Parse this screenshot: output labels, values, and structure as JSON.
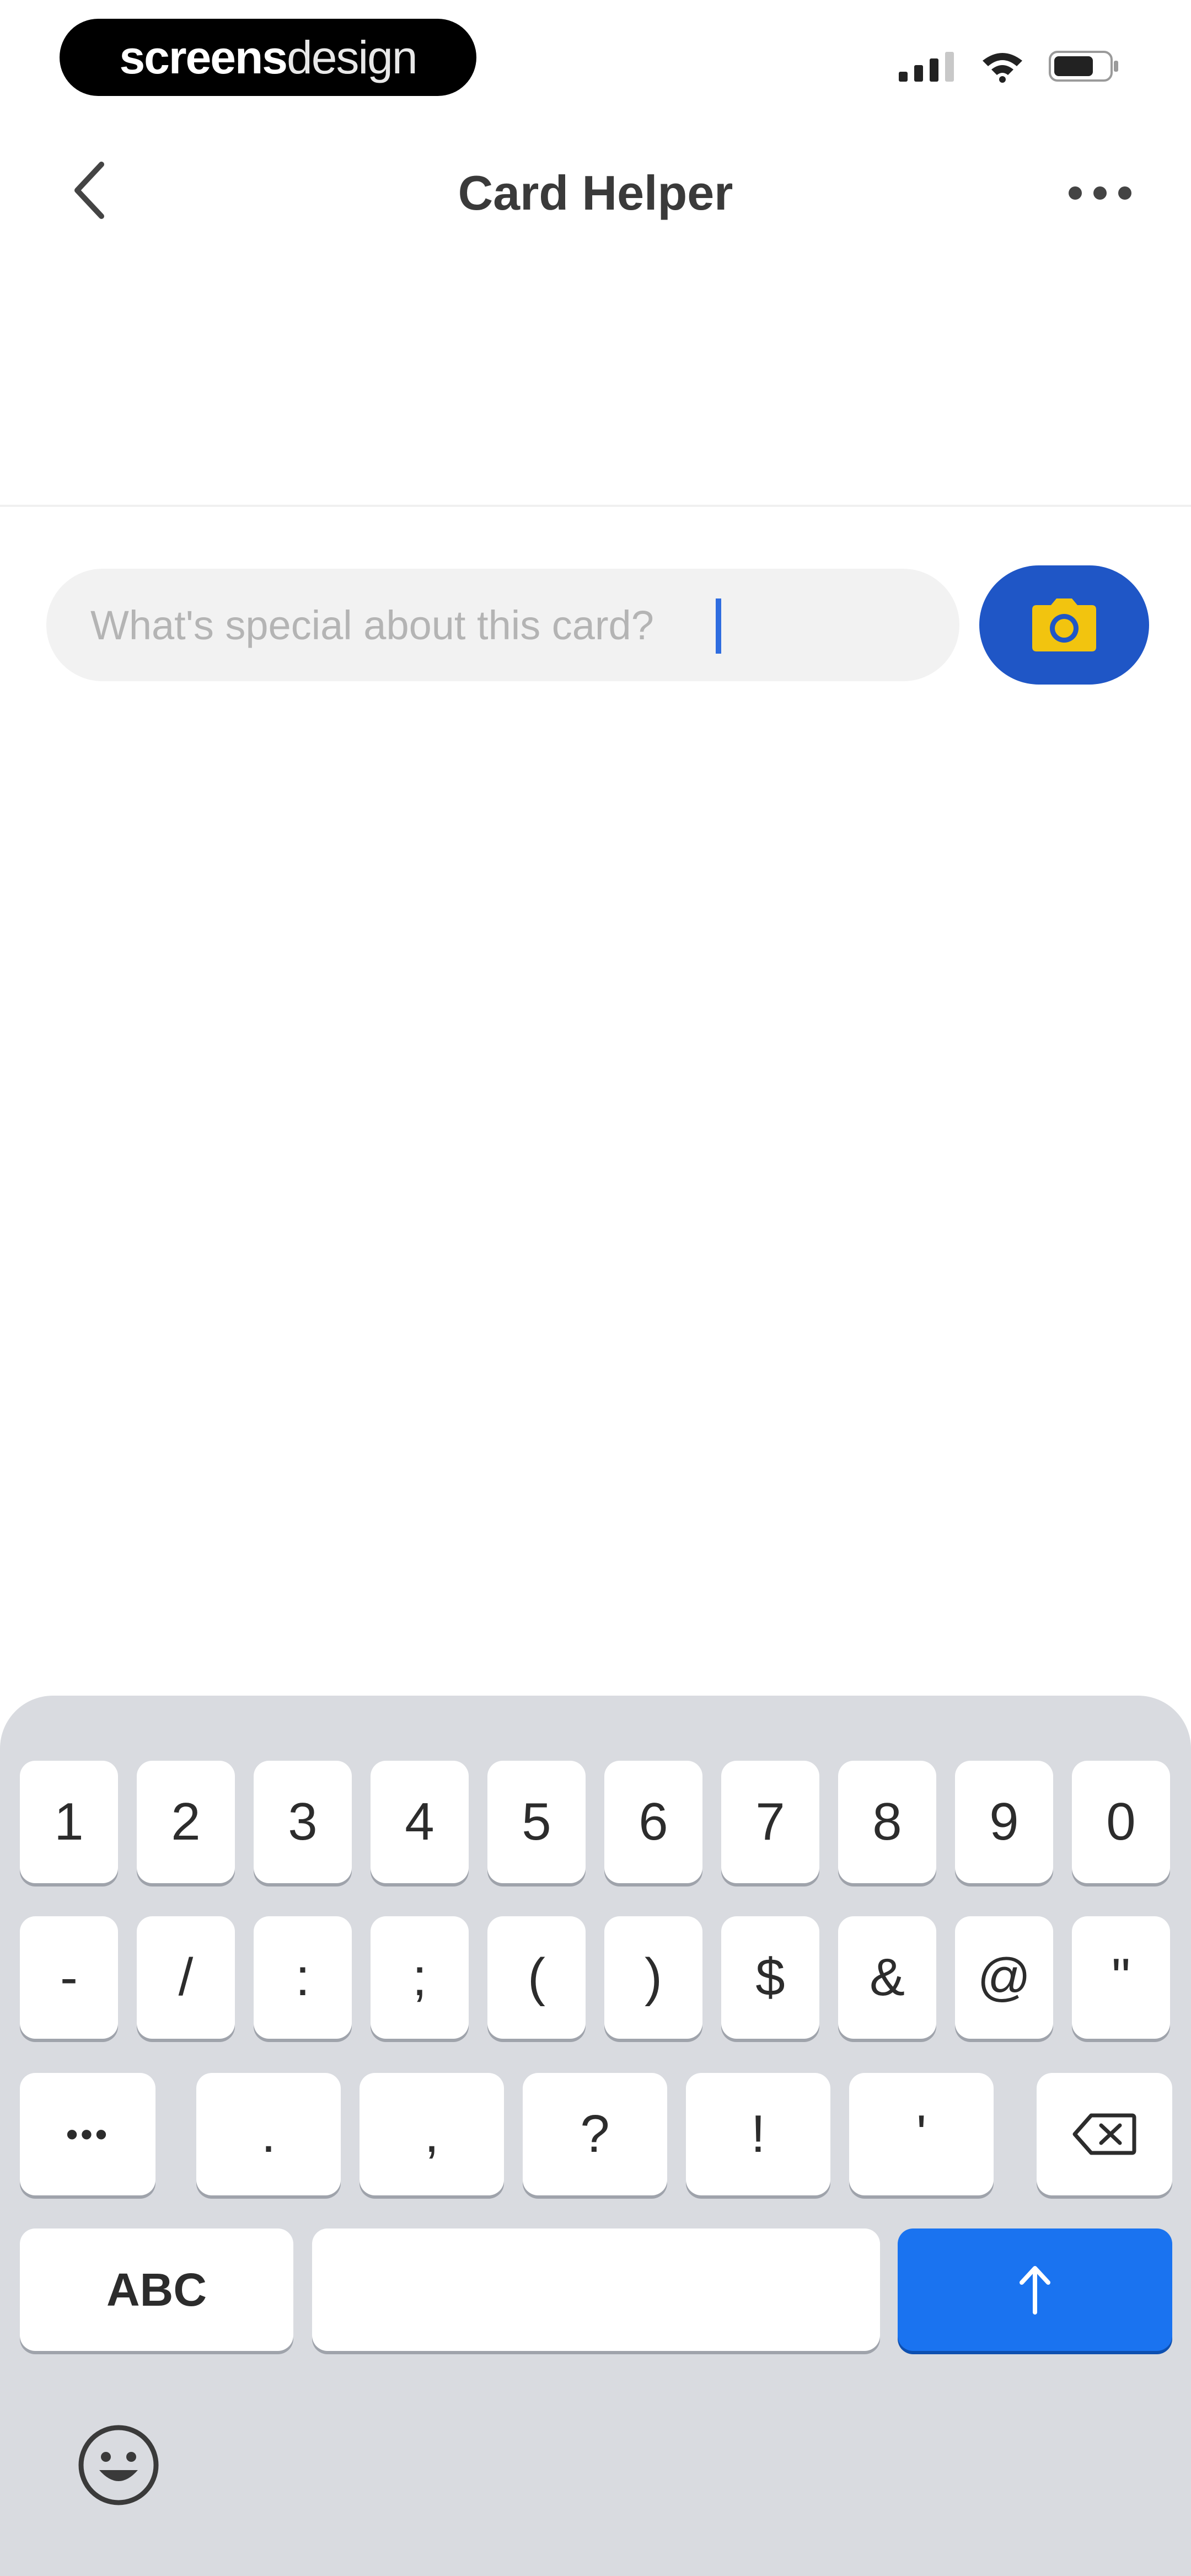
{
  "status_bar": {
    "brand_bold": "screens",
    "brand_light": "design",
    "icons": [
      "signal-icon",
      "wifi-icon",
      "battery-icon"
    ]
  },
  "nav": {
    "title": "Card Helper",
    "back_icon": "chevron-left-icon",
    "more_icon": "more-dots-icon"
  },
  "input": {
    "placeholder": "What's special about this card?",
    "value": "",
    "camera_icon": "camera-icon"
  },
  "colors": {
    "camera_button": "#1f56c6",
    "camera_icon": "#f2c40f",
    "return_key": "#1a73f0",
    "keyboard_bg": "#d9dbe0"
  },
  "keyboard": {
    "row1": [
      "1",
      "2",
      "3",
      "4",
      "5",
      "6",
      "7",
      "8",
      "9",
      "0"
    ],
    "row2": [
      "-",
      "/",
      ":",
      ";",
      "(",
      ")",
      "$",
      "&",
      "@",
      "\""
    ],
    "row3": [
      ".",
      ",",
      "?",
      "!",
      "'"
    ],
    "more_symbols": "•••",
    "abc": "ABC",
    "backspace_icon": "backspace-icon",
    "return_icon": "arrow-up-icon",
    "emoji_icon": "emoji-icon"
  }
}
